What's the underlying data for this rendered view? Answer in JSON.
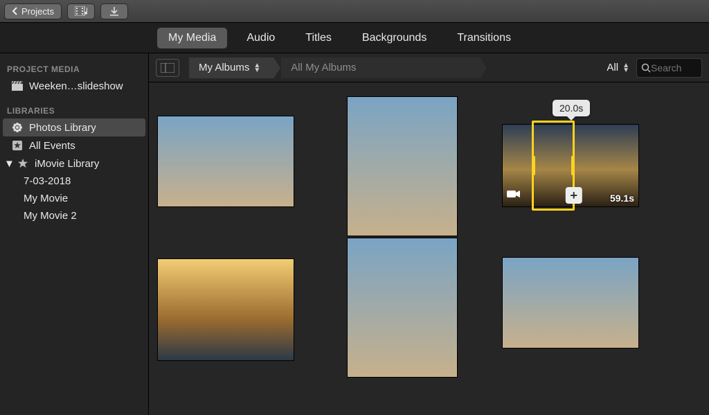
{
  "toolbar": {
    "back_label": "Projects"
  },
  "tabs": [
    "My Media",
    "Audio",
    "Titles",
    "Backgrounds",
    "Transitions"
  ],
  "active_tab": 0,
  "sidebar": {
    "hdr_project_media": "PROJECT MEDIA",
    "project_item": "Weeken…slideshow",
    "hdr_libraries": "LIBRARIES",
    "photos_library": "Photos Library",
    "all_events": "All Events",
    "imovie_library": "iMovie Library",
    "events": [
      "7-03-2018",
      "My Movie",
      "My Movie 2"
    ]
  },
  "filterbar": {
    "crumb1": "My Albums",
    "crumb2": "All My Albums",
    "filter_all": "All",
    "search_placeholder": "Search"
  },
  "media": {
    "video_selection_tooltip": "20.0s",
    "video_duration": "59.1s",
    "add_symbol": "+"
  }
}
